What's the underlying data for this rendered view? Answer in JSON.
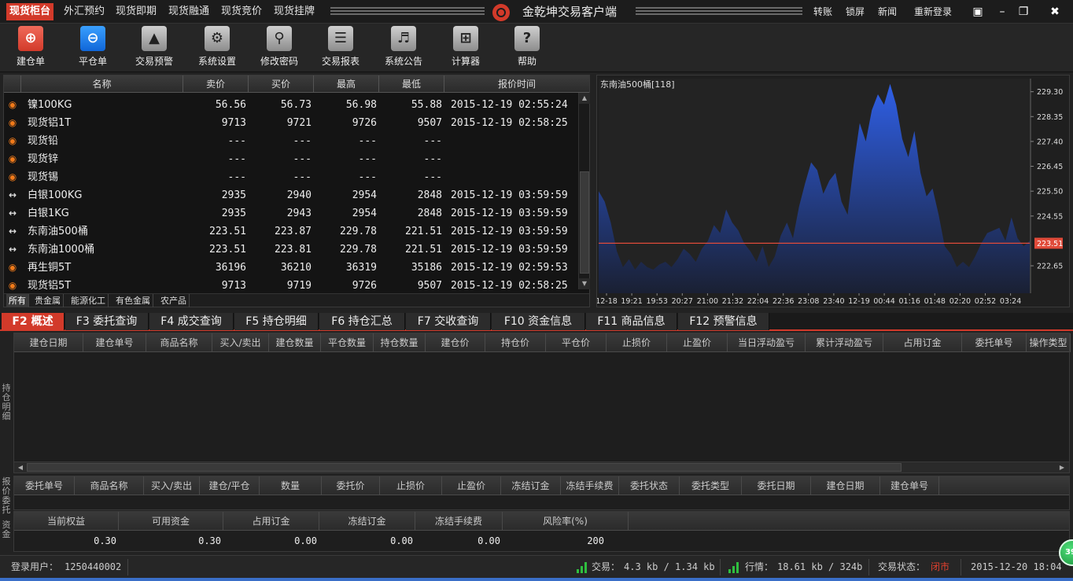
{
  "topbar": {
    "menu": [
      "现货柜台",
      "外汇预约",
      "现货即期",
      "现货融通",
      "现货竞价",
      "现货挂牌"
    ],
    "app_title": "金乾坤交易客户端",
    "links": [
      "转账",
      "锁屏",
      "新闻",
      "重新登录"
    ]
  },
  "toolbar": [
    {
      "label": "建仓单",
      "icon": "plus-circle-icon"
    },
    {
      "label": "平仓单",
      "icon": "minus-circle-icon"
    },
    {
      "label": "交易预警",
      "icon": "warning-icon"
    },
    {
      "label": "系统设置",
      "icon": "settings-icon"
    },
    {
      "label": "修改密码",
      "icon": "key-icon"
    },
    {
      "label": "交易报表",
      "icon": "report-icon"
    },
    {
      "label": "系统公告",
      "icon": "speaker-icon"
    },
    {
      "label": "计算器",
      "icon": "calculator-icon"
    },
    {
      "label": "帮助",
      "icon": "help-icon"
    }
  ],
  "quotes": {
    "headers": [
      "名称",
      "卖价",
      "买价",
      "最高",
      "最低",
      "报价时间"
    ],
    "rows": [
      {
        "icon": "lock",
        "name": "镍100KG",
        "sell": "56.56",
        "buy": "56.73",
        "high": "56.98",
        "low": "55.88",
        "time": "2015-12-19 02:55:24"
      },
      {
        "icon": "lock",
        "name": "现货铝1T",
        "sell": "9713",
        "buy": "9721",
        "high": "9726",
        "low": "9507",
        "time": "2015-12-19 02:58:25"
      },
      {
        "icon": "lock",
        "name": "现货铅",
        "sell": "---",
        "buy": "---",
        "high": "---",
        "low": "---",
        "time": ""
      },
      {
        "icon": "lock",
        "name": "现货锌",
        "sell": "---",
        "buy": "---",
        "high": "---",
        "low": "---",
        "time": ""
      },
      {
        "icon": "lock",
        "name": "现货锡",
        "sell": "---",
        "buy": "---",
        "high": "---",
        "low": "---",
        "time": ""
      },
      {
        "icon": "arrow",
        "name": "白银100KG",
        "sell": "2935",
        "buy": "2940",
        "high": "2954",
        "low": "2848",
        "time": "2015-12-19 03:59:59"
      },
      {
        "icon": "arrow",
        "name": "白银1KG",
        "sell": "2935",
        "buy": "2943",
        "high": "2954",
        "low": "2848",
        "time": "2015-12-19 03:59:59"
      },
      {
        "icon": "arrow",
        "name": "东南油500桶",
        "sell": "223.51",
        "buy": "223.87",
        "high": "229.78",
        "low": "221.51",
        "time": "2015-12-19 03:59:59"
      },
      {
        "icon": "arrow",
        "name": "东南油1000桶",
        "sell": "223.51",
        "buy": "223.81",
        "high": "229.78",
        "low": "221.51",
        "time": "2015-12-19 03:59:59"
      },
      {
        "icon": "lock",
        "name": "再生铜5T",
        "sell": "36196",
        "buy": "36210",
        "high": "36319",
        "low": "35186",
        "time": "2015-12-19 02:59:53"
      },
      {
        "icon": "lock",
        "name": "现货铝5T",
        "sell": "9713",
        "buy": "9719",
        "high": "9726",
        "low": "9507",
        "time": "2015-12-19 02:58:25"
      }
    ],
    "category_tabs": [
      "所有",
      "贵金属",
      "能源化工",
      "有色金属",
      "农产品"
    ]
  },
  "chart_data": {
    "type": "area",
    "title": "东南油500桶[118]",
    "x_ticks": [
      "12-18",
      "19:21",
      "19:53",
      "20:27",
      "21:00",
      "21:32",
      "22:04",
      "22:36",
      "23:08",
      "23:40",
      "12-19",
      "00:44",
      "01:16",
      "01:48",
      "02:20",
      "02:52",
      "03:24"
    ],
    "y_ticks": [
      "229.30",
      "228.35",
      "227.40",
      "226.45",
      "225.50",
      "224.55",
      "223.51",
      "222.65"
    ],
    "ylim": [
      221.6,
      229.8
    ],
    "current_price": "223.51",
    "colors": {
      "fill_top": "#2f5fe6",
      "fill_bottom": "#1a2033",
      "line": "#e04b3a"
    },
    "values": [
      225.5,
      225.1,
      224.3,
      223.2,
      222.6,
      222.9,
      222.5,
      222.8,
      222.6,
      222.5,
      222.7,
      222.8,
      222.6,
      222.9,
      223.3,
      223.1,
      222.8,
      223.3,
      223.6,
      224.2,
      223.9,
      224.8,
      224.3,
      224.0,
      223.5,
      223.2,
      222.8,
      223.4,
      222.6,
      223.0,
      223.8,
      224.3,
      223.7,
      224.9,
      225.8,
      226.6,
      226.3,
      225.4,
      225.9,
      226.2,
      225.1,
      224.6,
      226.5,
      228.1,
      227.4,
      228.6,
      229.2,
      228.8,
      229.6,
      228.8,
      227.5,
      226.8,
      227.8,
      226.2,
      225.3,
      225.6,
      224.6,
      223.4,
      223.1,
      222.6,
      222.8,
      222.6,
      223.0,
      223.5,
      223.9,
      224.0,
      224.1,
      223.6,
      224.5,
      223.7,
      223.4,
      223.6
    ]
  },
  "function_tabs": [
    "F2 概述",
    "F3 委托查询",
    "F4 成交查询",
    "F5 持仓明细",
    "F6 持仓汇总",
    "F7 交收查询",
    "F10 资金信息",
    "F11 商品信息",
    "F12 预警信息"
  ],
  "positions": {
    "side_label": "持仓明细",
    "headers": [
      "建仓日期",
      "建仓单号",
      "商品名称",
      "买入/卖出",
      "建仓数量",
      "平仓数量",
      "持仓数量",
      "建仓价",
      "持仓价",
      "平仓价",
      "止损价",
      "止盈价",
      "当日浮动盈亏",
      "累计浮动盈亏",
      "占用订金",
      "委托单号",
      "操作类型"
    ]
  },
  "orders": {
    "side_label": "报价委托",
    "headers": [
      "委托单号",
      "商品名称",
      "买入/卖出",
      "建仓/平仓",
      "数量",
      "委托价",
      "止损价",
      "止盈价",
      "冻结订金",
      "冻结手续费",
      "委托状态",
      "委托类型",
      "委托日期",
      "建仓日期",
      "建仓单号"
    ]
  },
  "funds": {
    "side_label": "资金",
    "headers": [
      "当前权益",
      "可用资金",
      "占用订金",
      "冻结订金",
      "冻结手续费",
      "风险率(%)"
    ],
    "values": [
      "0.30",
      "0.30",
      "0.00",
      "0.00",
      "0.00",
      "200"
    ]
  },
  "status": {
    "user_label": "登录用户：",
    "user_id": "1250440002",
    "trade_label": "交易：",
    "trade_value": "4.3 kb / 1.34 kb",
    "market_label": "行情：",
    "market_value": "18.61 kb / 324b",
    "state_label": "交易状态：",
    "state_value": "闭市",
    "state_color": "#e0402e",
    "datetime": "2015-12-20 18:04",
    "badge": "39"
  }
}
